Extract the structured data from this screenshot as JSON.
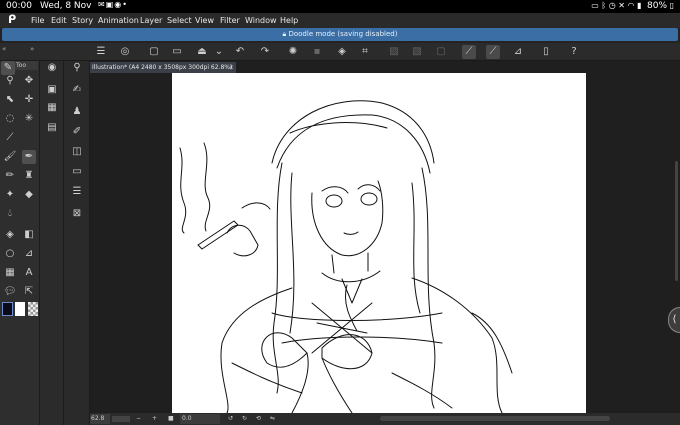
{
  "status_bar": {
    "time": "00:00",
    "date": "Wed, 8 Nov",
    "notification_icons": [
      "message-icon",
      "gallery-icon",
      "messenger-icon",
      "dot-icon"
    ],
    "battery": "80%",
    "right_icons": [
      "image-icon",
      "bluetooth-icon",
      "alarm-icon",
      "mute-icon",
      "wifi-icon",
      "signal-icon",
      "battery-icon"
    ]
  },
  "menu": {
    "items": [
      "File",
      "Edit",
      "Story",
      "Animation",
      "Layer",
      "Select",
      "View",
      "Filter",
      "Window",
      "Help"
    ]
  },
  "banner": {
    "text": "Doodle mode (saving disabled)"
  },
  "command_bar": {
    "icons": [
      "menu-icon",
      "clip-studio-icon",
      "new-icon",
      "open-icon",
      "save-icon",
      "chevron-down-icon",
      "undo-icon",
      "redo-icon",
      "loading-icon",
      "clear-icon",
      "fill-icon",
      "crop-icon",
      "deselect-icon",
      "invert-icon",
      "show-selection-icon",
      "pen-pressure-icon",
      "stabilizer-icon",
      "ruler-icon",
      "smartphone-icon",
      "help-icon"
    ]
  },
  "tool_panel": {
    "tab_label": "Too",
    "tools_a": [
      "zoom-icon",
      "move-icon",
      "operation-icon",
      "pan-icon",
      "lasso-icon",
      "magic-wand-icon",
      "eyedropper-icon",
      "eyedropper-alt-icon",
      "brush-icon",
      "pen-icon",
      "pencil-icon",
      "airbrush-icon",
      "sparkle-icon",
      "eraser-icon",
      "blend-icon",
      "fill-icon",
      "gradient-icon",
      "circle-icon",
      "ruler-icon",
      "frame-icon",
      "text-icon",
      "balloon-icon",
      "correct-line-icon"
    ],
    "tools_b": [
      "target-icon",
      "brush-shape-icon",
      "grid-icon",
      "film-icon",
      "layers-icon",
      "hand-icon",
      "record-icon",
      "rotate-icon",
      "speed-icon",
      "palette-icon"
    ],
    "tools_c": [
      "search-icon",
      "pen-brush-icon",
      "airbrush-alt-icon",
      "sketch-icon",
      "layers-alt-icon",
      "image-icon",
      "stack-icon",
      "transform-icon"
    ]
  },
  "colors": {
    "main": "#0a0a1a",
    "sub": "#ffffff",
    "banner": "#3a6ea5"
  },
  "document": {
    "tab_title": "Illustration* (A4 2480 x 3508px 300dpi 62.8%)",
    "close_glyph": "x"
  },
  "bottom_bar": {
    "zoom": "62.8",
    "minus": "−",
    "plus": "+",
    "rotate": "0.0"
  }
}
